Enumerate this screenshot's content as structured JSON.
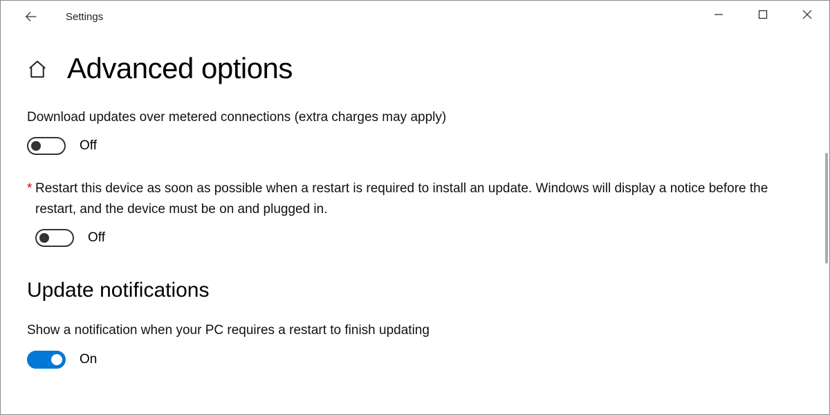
{
  "window": {
    "title": "Settings"
  },
  "page": {
    "title": "Advanced options"
  },
  "settings": {
    "metered": {
      "label": "Download updates over metered connections (extra charges may apply)",
      "state_text": "Off",
      "on": false
    },
    "restart_asap": {
      "asterisk": "*",
      "label": "Restart this device as soon as possible when a restart is required to install an update. Windows will display a notice before the restart, and the device must be on and plugged in.",
      "state_text": "Off",
      "on": false
    }
  },
  "section": {
    "notifications_heading": "Update notifications",
    "show_notification": {
      "label": "Show a notification when your PC requires a restart to finish updating",
      "state_text": "On",
      "on": true
    }
  }
}
